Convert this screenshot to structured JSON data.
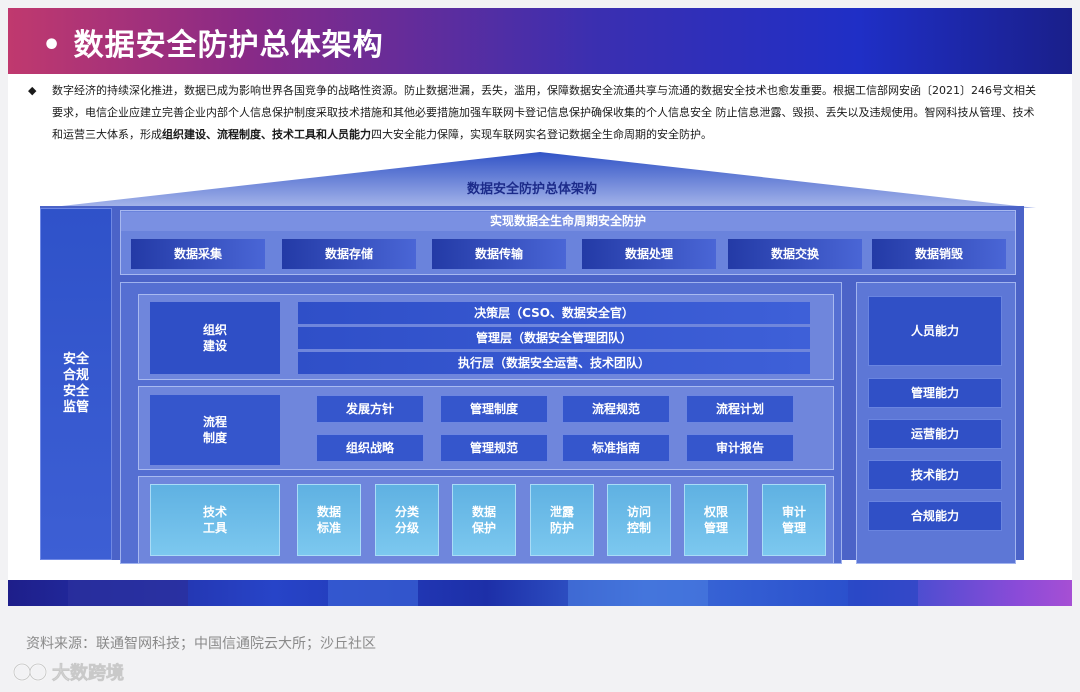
{
  "title": "• 数据安全防护总体架构",
  "intro": {
    "bullet": "◆",
    "text_before": "数字经济的持续深化推进，数据已成为影响世界各国竞争的战略性资源。防止数据泄漏，丢失，滥用，保障数据安全流通共享与流通的数据安全技术也愈发重要。根据工信部网安函〔2021〕246号文相关要求，电信企业应建立完善企业内部个人信息保护制度采取技术措施和其他必要措施加强车联网卡登记信息保护确保收集的个人信息安全 防止信息泄露、毁损、丢失以及违规使用。智网科技从管理、技术和运营三大体系，形成",
    "text_bold": "组织建设、流程制度、技术工具和人员能力",
    "text_after": "四大安全能力保障，实现车联网实名登记数据全生命周期的安全防护。"
  },
  "diagram": {
    "roof_label": "数据安全防护总体架构",
    "sidebar_label": "安全\n合规\n安全\n监管",
    "lifecycle_title": "实现数据全生命周期安全防护",
    "stages": [
      "数据采集",
      "数据存储",
      "数据传输",
      "数据处理",
      "数据交换",
      "数据销毁"
    ],
    "org": {
      "head": "组织\n建设",
      "layers": [
        "决策层（CSO、数据安全官）",
        "管理层（数据安全管理团队）",
        "执行层（数据安全运营、技术团队）"
      ]
    },
    "process": {
      "head": "流程\n制度",
      "items": [
        "发展方针",
        "管理制度",
        "流程规范",
        "流程计划",
        "组织战略",
        "管理规范",
        "标准指南",
        "审计报告"
      ]
    },
    "tools": {
      "head": "技术\n工具",
      "items": [
        "数据\n标准",
        "分类\n分级",
        "数据\n保护",
        "泄露\n防护",
        "访问\n控制",
        "权限\n管理",
        "审计\n管理"
      ]
    },
    "people": {
      "head": "人员能力",
      "items": [
        "管理能力",
        "运营能力",
        "技术能力",
        "合规能力"
      ]
    }
  },
  "source": "资料来源：联通智网科技；中国信通院云大所；沙丘社区",
  "watermark_logo": "大数跨境",
  "colors": {
    "banner_start": "#c0396e",
    "banner_end": "#1a1f8a",
    "frame_blue": "#4b63c8",
    "tool_cyan": "#6cbde8",
    "dark_label": "#1c2b8a"
  }
}
